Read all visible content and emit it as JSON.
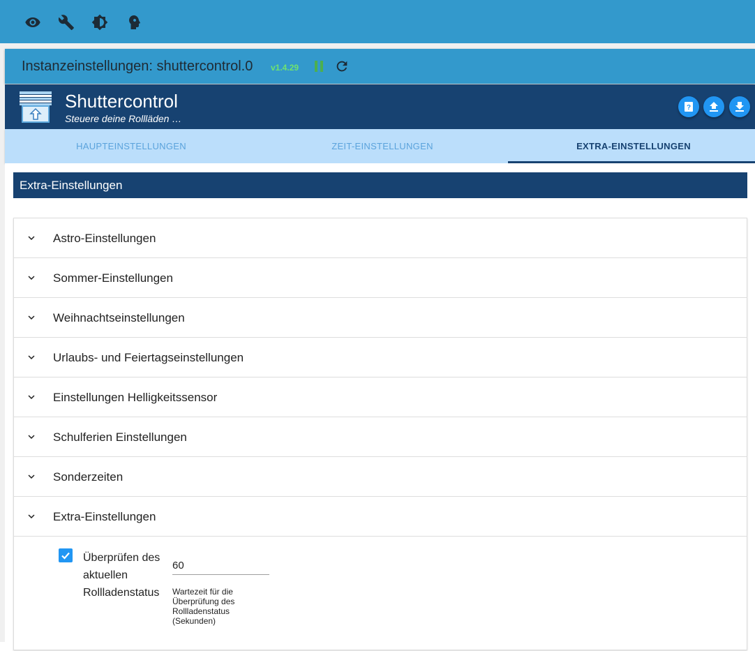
{
  "toolbar": {
    "icons": [
      "eye-icon",
      "wrench-icon",
      "brightness-icon",
      "head-icon"
    ]
  },
  "instance": {
    "title": "Instanzeinstellungen: shuttercontrol.0",
    "version": "v1.4.29"
  },
  "adapter": {
    "name": "Shuttercontrol",
    "description": "Steuere deine Rollläden …"
  },
  "tabs": [
    {
      "label": "HAUPTEINSTELLUNGEN",
      "active": false
    },
    {
      "label": "ZEIT-EINSTELLUNGEN",
      "active": false
    },
    {
      "label": "EXTRA-EINSTELLUNGEN",
      "active": true
    }
  ],
  "section": {
    "title": "Extra-Einstellungen"
  },
  "accordion": [
    {
      "label": "Astro-Einstellungen"
    },
    {
      "label": "Sommer-Einstellungen"
    },
    {
      "label": "Weihnachtseinstellungen"
    },
    {
      "label": "Urlaubs- und Feiertagseinstellungen"
    },
    {
      "label": "Einstellungen Helligkeitssensor"
    },
    {
      "label": "Schulferien Einstellungen"
    },
    {
      "label": "Sonderzeiten"
    },
    {
      "label": "Extra-Einstellungen"
    }
  ],
  "extra": {
    "checkbox_label": "Überprüfen des aktuellen Rollladenstatus",
    "checked": true,
    "input_value": "60",
    "input_help": "Wartezeit für die Überprüfung des Rollladenstatus (Sekunden)"
  },
  "colors": {
    "primary": "#3399cc",
    "header": "#174271",
    "tabs_bg": "#bbdefb",
    "accent": "#2196f3",
    "version": "#6fe36f"
  }
}
